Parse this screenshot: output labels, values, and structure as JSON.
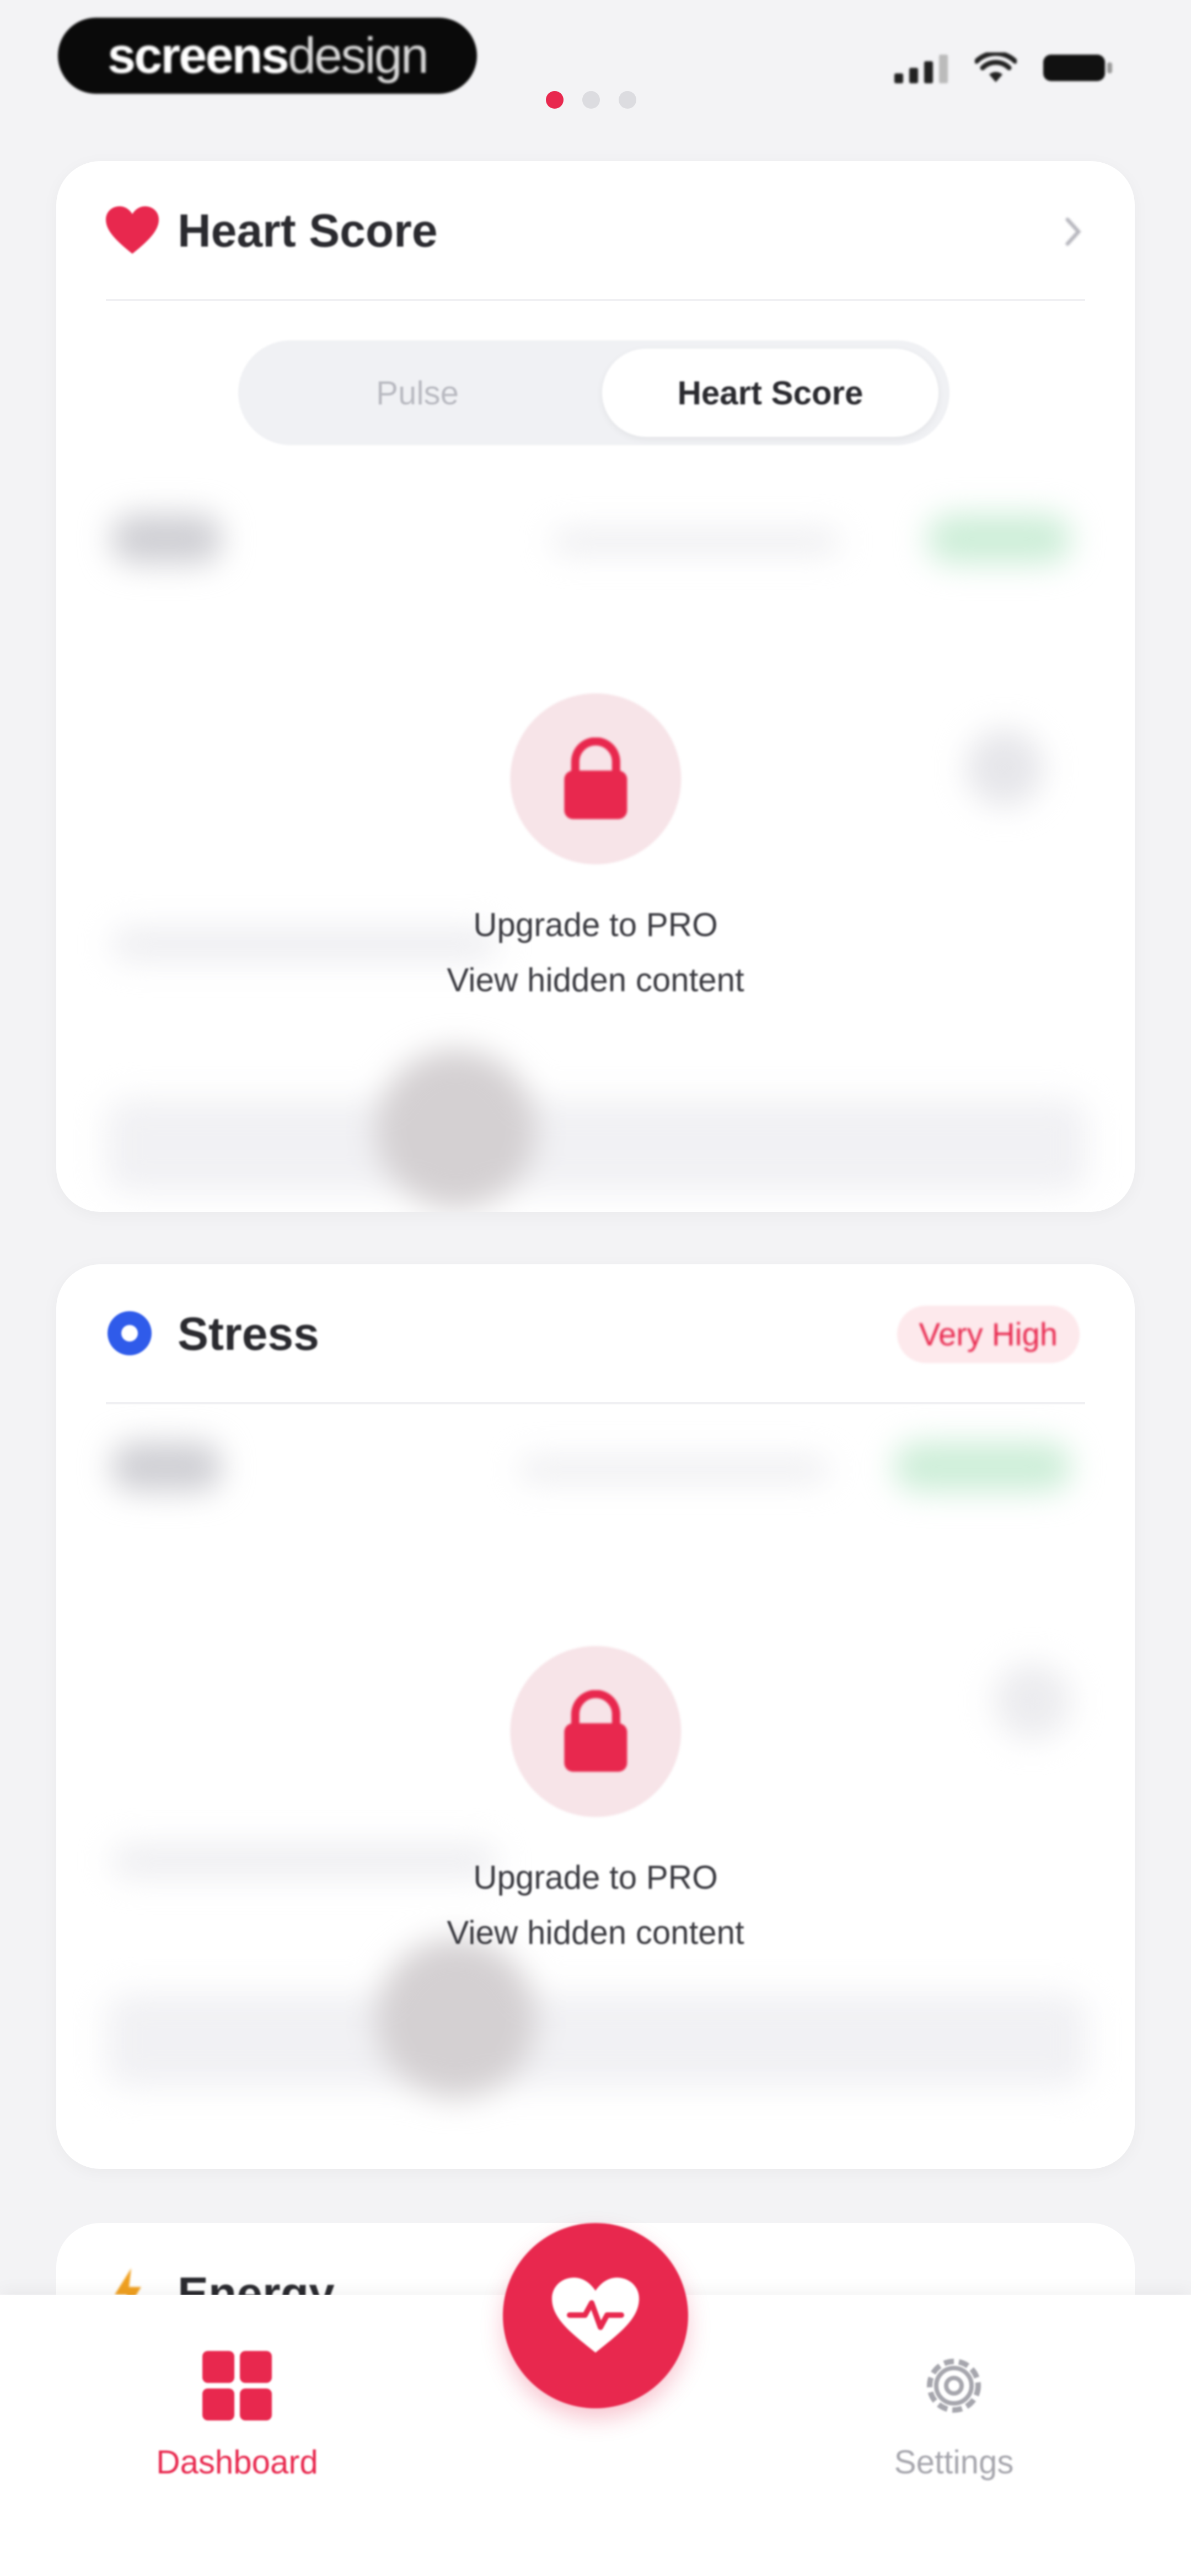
{
  "status_bar": {
    "brand_bold": "screens",
    "brand_light": "design",
    "page_dots": 3,
    "active_dot": 0
  },
  "colors": {
    "accent": "#e8284e",
    "stress_blue": "#2f5bea",
    "energy_orange": "#f0a020",
    "inactive_nav": "#a6a6ad"
  },
  "heart_card": {
    "title": "Heart Score",
    "icon": "heart-icon",
    "chevron": "chevron-right-icon",
    "segmented": {
      "left": "Pulse",
      "right": "Heart Score",
      "selected": "Heart Score"
    },
    "locked": {
      "line1": "Upgrade to PRO",
      "line2": "View hidden content"
    }
  },
  "stress_card": {
    "title": "Stress",
    "icon": "stress-dot-icon",
    "badge": "Very High",
    "locked": {
      "line1": "Upgrade to PRO",
      "line2": "View hidden content"
    }
  },
  "energy_card": {
    "title": "Energy",
    "icon": "bolt-icon"
  },
  "bottom_nav": {
    "dashboard": "Dashboard",
    "settings": "Settings",
    "fab_icon": "heart-pulse-icon",
    "active": "Dashboard"
  }
}
